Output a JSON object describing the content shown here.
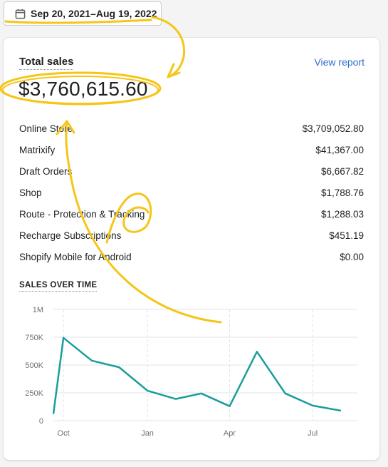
{
  "date_range": {
    "label": "Sep 20, 2021–Aug 19, 2022",
    "icon": "calendar-icon"
  },
  "card": {
    "title": "Total sales",
    "view_report": "View report",
    "total": "$3,760,615.60",
    "breakdown": [
      {
        "label": "Online Store",
        "value": "$3,709,052.80"
      },
      {
        "label": "Matrixify",
        "value": "$41,367.00"
      },
      {
        "label": "Draft Orders",
        "value": "$6,667.82"
      },
      {
        "label": "Shop",
        "value": "$1,788.76"
      },
      {
        "label": "Route - Protection & Tracking",
        "value": "$1,288.03"
      },
      {
        "label": "Recharge Subscriptions",
        "value": "$451.19"
      },
      {
        "label": "Shopify Mobile for Android",
        "value": "$0.00"
      }
    ],
    "section_title": "SALES OVER TIME"
  },
  "colors": {
    "accent_link": "#2c6ecb",
    "line": "#1a9e9b",
    "highlight": "#f5c518"
  },
  "chart_data": {
    "type": "line",
    "y_ticks": [
      "1M",
      "750K",
      "500K",
      "250K",
      "0"
    ],
    "ylim": [
      0,
      1000000
    ],
    "x_ticks": [
      "Oct",
      "Jan",
      "Apr",
      "Jul"
    ],
    "x": [
      "2021-09-20",
      "2021-10-01",
      "2021-11-01",
      "2021-12-01",
      "2022-01-01",
      "2022-02-01",
      "2022-03-01",
      "2022-04-01",
      "2022-05-01",
      "2022-06-01",
      "2022-07-01",
      "2022-08-01"
    ],
    "values": [
      60000,
      745000,
      540000,
      480000,
      270000,
      195000,
      245000,
      130000,
      620000,
      245000,
      135000,
      90000
    ],
    "grid": true
  }
}
